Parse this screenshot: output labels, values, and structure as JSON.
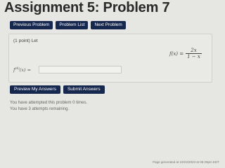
{
  "page": {
    "title": "Assignment 5: Problem 7"
  },
  "nav": {
    "previous_label": "Previous Problem",
    "list_label": "Problem List",
    "next_label": "Next Problem"
  },
  "problem": {
    "points_label": "(1 point) Let",
    "function_lhs": "f(x) =",
    "numerator": "2x",
    "denominator": "1 − x",
    "derivative_prefix": "f",
    "derivative_order": "(4)",
    "derivative_suffix": "(x) =",
    "answer_value": ""
  },
  "actions": {
    "preview_label": "Preview My Answers",
    "submit_label": "Submit Answers"
  },
  "status": {
    "attempted": "You have attempted this problem 0 times.",
    "remaining": "You have 3 attempts remaining."
  },
  "footer": {
    "generated": "Page generated at 10/23/2023 at 06:29pm EDT"
  }
}
